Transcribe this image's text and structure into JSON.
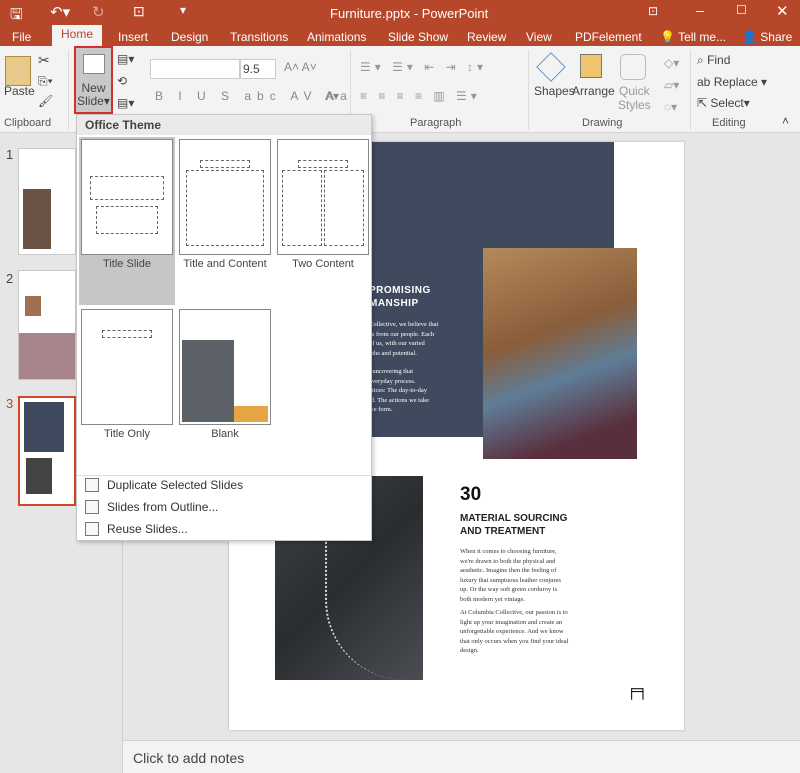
{
  "titlebar": {
    "title": "Furniture.pptx - PowerPoint"
  },
  "tabs": [
    "File",
    "Home",
    "Insert",
    "Design",
    "Transitions",
    "Animations",
    "Slide Show",
    "Review",
    "View",
    "PDFelement",
    "Tell me...",
    "Share"
  ],
  "ribbon": {
    "clipboard": {
      "paste": "Paste",
      "label": "Clipboard"
    },
    "new_slide": {
      "line1": "New",
      "line2": "Slide"
    },
    "font_size": "9.5",
    "paragraph": "Paragraph",
    "drawing": {
      "shapes": "Shapes",
      "arrange": "Arrange",
      "quick_styles": [
        "Quick",
        "Styles"
      ],
      "label": "Drawing"
    },
    "editing": {
      "find": "Find",
      "replace": "Replace",
      "select": "Select",
      "label": "Editing"
    }
  },
  "menu": {
    "header": "Office Theme",
    "layouts": [
      "Title Slide",
      "Title and Content",
      "Two Content",
      "Title Only",
      "Blank"
    ],
    "items": [
      "Duplicate Selected Slides",
      "Slides from Outline...",
      "Reuse Slides..."
    ]
  },
  "thumbnails": [
    "1",
    "2",
    "3"
  ],
  "slide": {
    "heading1": "PROMISING",
    "heading2": "MANSHIP",
    "para1": [
      "Collective, we believe that",
      "es from our people. Each",
      "of us, with our varied",
      "gths and potential."
    ],
    "para2": [
      "t uncovering that",
      "everyday process.",
      "ctices: The day-to-day",
      "ld. The actions we take",
      "we form."
    ],
    "number": "30",
    "title1": "MATERIAL SOURCING",
    "title2": "AND TREATMENT",
    "body1": [
      "When it comes to choosing furniture,",
      "we're drawn to both the physical and",
      "aesthetic. Imagine then the feeling of",
      "luxury that sumptuous leather conjures",
      "up. Or the way soft green corduroy is",
      "both modern yet vintage."
    ],
    "body2": [
      "At Columbia Collective, our passion is to",
      "light up your imagination and create an",
      "unforgettable experience. And we know",
      "that only occurs when you find your ideal",
      "design."
    ]
  },
  "notes": "Click to add notes",
  "colors": {
    "accent": "#b7472a",
    "slide_panel": "#3f4a5e"
  }
}
